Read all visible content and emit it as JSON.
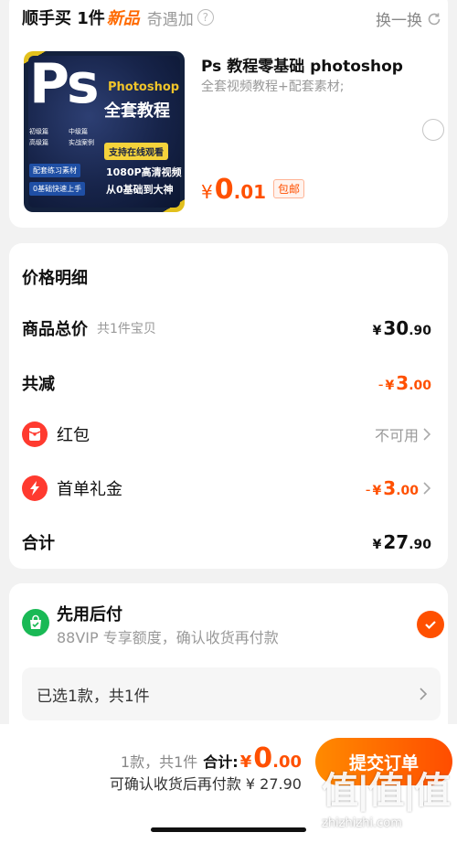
{
  "header": {
    "prefix": "顺手买 1件",
    "new_tag": "新品",
    "subtitle": "奇遇加",
    "help": "?",
    "swap_label": "换一换"
  },
  "product": {
    "image": {
      "ps": "Ps",
      "photoshop": "Photoshop",
      "title": "全套教程",
      "tags": [
        "初级篇",
        "中级篇",
        "高级篇",
        "实战案例"
      ],
      "online": "支持在线观看",
      "btn1": "配套练习素材",
      "btn2": "0基础快速上手",
      "hd": "1080P高清视频",
      "zero": "从0基础到大神"
    },
    "title": "Ps 教程零基础 photoshop",
    "subtitle": "全套视频教程+配套素材;",
    "price_currency": "¥",
    "price_int": "0",
    "price_dec": ".01",
    "shipping_badge": "包邮",
    "selected": false
  },
  "price_detail": {
    "title": "价格明细",
    "total": {
      "label": "商品总价",
      "sub": "共1件宝贝",
      "currency": "¥",
      "int": "30",
      "dec": ".90"
    },
    "reduce": {
      "label": "共减",
      "sign": "-",
      "currency": "¥",
      "int": "3",
      "dec": ".00"
    },
    "redpacket": {
      "label": "红包",
      "value": "不可用"
    },
    "first_gift": {
      "label": "首单礼金",
      "sign": "-",
      "currency": "¥",
      "int": "3",
      "dec": ".00"
    },
    "sum": {
      "label": "合计",
      "currency": "¥",
      "int": "27",
      "dec": ".90"
    }
  },
  "payment": {
    "title": "先用后付",
    "subtitle": "88VIP 专享额度，确认收货再付款",
    "checked": true,
    "selection": "已选1款，共1件"
  },
  "footer": {
    "count": "1款，共1件",
    "sum_label": "合计:",
    "currency": "¥",
    "int": "0",
    "dec": ".00",
    "later": "可确认收货后再付款 ¥ 27.90",
    "submit": "提交订单",
    "watermark": "值|值|值",
    "watermark_url": "zhizhizhi.com"
  },
  "colors": {
    "accent": "#ff5000",
    "green": "#19b955",
    "red_icon": "#ff3a2f"
  }
}
